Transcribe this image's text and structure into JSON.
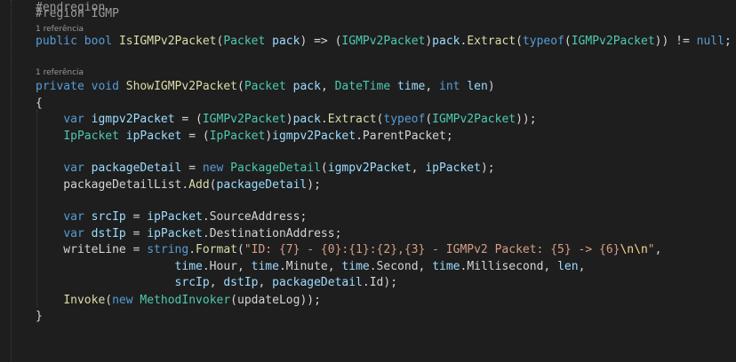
{
  "editor": {
    "codelens_label": "1 referência",
    "lines": [
      {
        "tokens": [
          {
            "t": "#region IGMP",
            "c": "region"
          }
        ]
      },
      {
        "tokens": [
          {
            "t": "public",
            "c": "kw"
          },
          {
            "t": " "
          },
          {
            "t": "bool",
            "c": "kw"
          },
          {
            "t": " "
          },
          {
            "t": "IsIGMPv2Packet",
            "c": "method"
          },
          {
            "t": "("
          },
          {
            "t": "Packet",
            "c": "type"
          },
          {
            "t": " "
          },
          {
            "t": "pack",
            "c": "local"
          },
          {
            "t": ") => ("
          },
          {
            "t": "IGMPv2Packet",
            "c": "type"
          },
          {
            "t": ")"
          },
          {
            "t": "pack",
            "c": "local"
          },
          {
            "t": "."
          },
          {
            "t": "Extract",
            "c": "method"
          },
          {
            "t": "("
          },
          {
            "t": "typeof",
            "c": "kw"
          },
          {
            "t": "("
          },
          {
            "t": "IGMPv2Packet",
            "c": "type"
          },
          {
            "t": ")) != "
          },
          {
            "t": "null",
            "c": "kw"
          },
          {
            "t": ";"
          }
        ]
      },
      {
        "tokens": []
      },
      {
        "tokens": [
          {
            "t": "private",
            "c": "kw"
          },
          {
            "t": " "
          },
          {
            "t": "void",
            "c": "kw"
          },
          {
            "t": " "
          },
          {
            "t": "ShowIGMPv2Packet",
            "c": "method"
          },
          {
            "t": "("
          },
          {
            "t": "Packet",
            "c": "type"
          },
          {
            "t": " "
          },
          {
            "t": "pack",
            "c": "local"
          },
          {
            "t": ", "
          },
          {
            "t": "DateTime",
            "c": "type"
          },
          {
            "t": " "
          },
          {
            "t": "time",
            "c": "local"
          },
          {
            "t": ", "
          },
          {
            "t": "int",
            "c": "kw"
          },
          {
            "t": " "
          },
          {
            "t": "len",
            "c": "local"
          },
          {
            "t": ")"
          }
        ]
      },
      {
        "tokens": [
          {
            "t": "{"
          }
        ]
      },
      {
        "tokens": [
          {
            "t": "    "
          },
          {
            "t": "var",
            "c": "kw"
          },
          {
            "t": " "
          },
          {
            "t": "igmpv2Packet",
            "c": "local"
          },
          {
            "t": " = ("
          },
          {
            "t": "IGMPv2Packet",
            "c": "type"
          },
          {
            "t": ")"
          },
          {
            "t": "pack",
            "c": "local"
          },
          {
            "t": "."
          },
          {
            "t": "Extract",
            "c": "method"
          },
          {
            "t": "("
          },
          {
            "t": "typeof",
            "c": "kw"
          },
          {
            "t": "("
          },
          {
            "t": "IGMPv2Packet",
            "c": "type"
          },
          {
            "t": "));"
          }
        ]
      },
      {
        "tokens": [
          {
            "t": "    "
          },
          {
            "t": "IpPacket",
            "c": "type"
          },
          {
            "t": " "
          },
          {
            "t": "ipPacket",
            "c": "local"
          },
          {
            "t": " = ("
          },
          {
            "t": "IpPacket",
            "c": "type"
          },
          {
            "t": ")"
          },
          {
            "t": "igmpv2Packet",
            "c": "local"
          },
          {
            "t": ".ParentPacket;"
          }
        ]
      },
      {
        "tokens": []
      },
      {
        "tokens": [
          {
            "t": "    "
          },
          {
            "t": "var",
            "c": "kw"
          },
          {
            "t": " "
          },
          {
            "t": "packageDetail",
            "c": "local"
          },
          {
            "t": " = "
          },
          {
            "t": "new",
            "c": "kw"
          },
          {
            "t": " "
          },
          {
            "t": "PackageDetail",
            "c": "type"
          },
          {
            "t": "("
          },
          {
            "t": "igmpv2Packet",
            "c": "local"
          },
          {
            "t": ", "
          },
          {
            "t": "ipPacket",
            "c": "local"
          },
          {
            "t": ");"
          }
        ]
      },
      {
        "tokens": [
          {
            "t": "    packageDetailList."
          },
          {
            "t": "Add",
            "c": "method"
          },
          {
            "t": "("
          },
          {
            "t": "packageDetail",
            "c": "local"
          },
          {
            "t": ");"
          }
        ]
      },
      {
        "tokens": []
      },
      {
        "tokens": [
          {
            "t": "    "
          },
          {
            "t": "var",
            "c": "kw"
          },
          {
            "t": " "
          },
          {
            "t": "srcIp",
            "c": "local"
          },
          {
            "t": " = "
          },
          {
            "t": "ipPacket",
            "c": "local"
          },
          {
            "t": ".SourceAddress;"
          }
        ]
      },
      {
        "tokens": [
          {
            "t": "    "
          },
          {
            "t": "var",
            "c": "kw"
          },
          {
            "t": " "
          },
          {
            "t": "dstIp",
            "c": "local"
          },
          {
            "t": " = "
          },
          {
            "t": "ipPacket",
            "c": "local"
          },
          {
            "t": ".DestinationAddress;"
          }
        ]
      },
      {
        "tokens": [
          {
            "t": "    writeLine = "
          },
          {
            "t": "string",
            "c": "kw"
          },
          {
            "t": "."
          },
          {
            "t": "Format",
            "c": "method"
          },
          {
            "t": "("
          },
          {
            "t": "\"ID: {7} - {0}:{1}:{2},{3} - IGMPv2 Packet: {5} -> {6}",
            "c": "str"
          },
          {
            "t": "\\n\\n",
            "c": "esc"
          },
          {
            "t": "\"",
            "c": "str"
          },
          {
            "t": ","
          }
        ]
      },
      {
        "tokens": [
          {
            "t": "                    "
          },
          {
            "t": "time",
            "c": "local"
          },
          {
            "t": ".Hour, "
          },
          {
            "t": "time",
            "c": "local"
          },
          {
            "t": ".Minute, "
          },
          {
            "t": "time",
            "c": "local"
          },
          {
            "t": ".Second, "
          },
          {
            "t": "time",
            "c": "local"
          },
          {
            "t": ".Millisecond, "
          },
          {
            "t": "len",
            "c": "local"
          },
          {
            "t": ","
          }
        ]
      },
      {
        "tokens": [
          {
            "t": "                    "
          },
          {
            "t": "srcIp",
            "c": "local"
          },
          {
            "t": ", "
          },
          {
            "t": "dstIp",
            "c": "local"
          },
          {
            "t": ", "
          },
          {
            "t": "packageDetail",
            "c": "local"
          },
          {
            "t": ".Id);"
          }
        ]
      },
      {
        "tokens": [
          {
            "t": "    "
          },
          {
            "t": "Invoke",
            "c": "method"
          },
          {
            "t": "("
          },
          {
            "t": "new",
            "c": "kw"
          },
          {
            "t": " "
          },
          {
            "t": "MethodInvoker",
            "c": "type"
          },
          {
            "t": "(updateLog));"
          }
        ]
      },
      {
        "tokens": [
          {
            "t": "}"
          }
        ]
      },
      {
        "tokens": []
      },
      {
        "tokens": []
      },
      {
        "tokens": [
          {
            "t": "#endregion",
            "c": "region"
          }
        ]
      }
    ]
  }
}
